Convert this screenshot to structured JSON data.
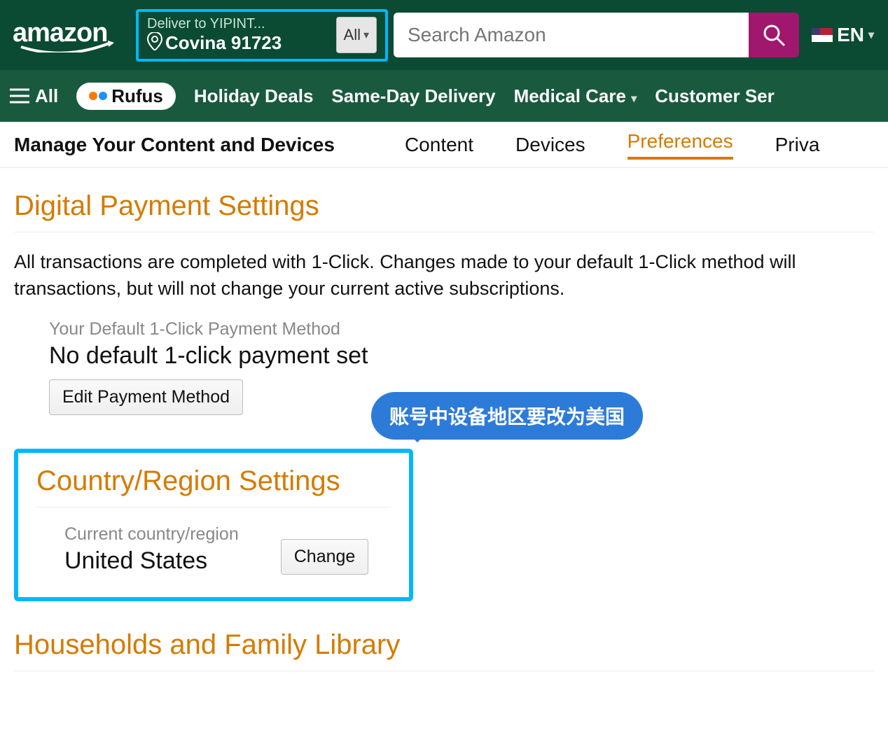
{
  "header": {
    "logo_text": "amazon",
    "deliver_to": "Deliver to YIPINT...",
    "deliver_city": "Covina 91723",
    "search_category": "All",
    "search_placeholder": "Search Amazon",
    "lang": "EN"
  },
  "nav": {
    "all": "All",
    "rufus": "Rufus",
    "items": [
      "Holiday Deals",
      "Same-Day Delivery",
      "Medical Care",
      "Customer Ser"
    ]
  },
  "tabs": {
    "title": "Manage Your Content and Devices",
    "items": [
      "Content",
      "Devices",
      "Preferences",
      "Priva"
    ],
    "active": 2
  },
  "payment": {
    "heading": "Digital Payment Settings",
    "desc": "All transactions are completed with 1-Click. Changes made to your default 1-Click method will transactions, but will not change your current active subscriptions.",
    "method_label": "Your Default 1-Click Payment Method",
    "method_value": "No default 1-click payment set",
    "edit_btn": "Edit Payment Method"
  },
  "callout": "账号中设备地区要改为美国",
  "country": {
    "heading": "Country/Region Settings",
    "label": "Current country/region",
    "value": "United States",
    "change_btn": "Change"
  },
  "households": {
    "heading": "Households and Family Library"
  }
}
